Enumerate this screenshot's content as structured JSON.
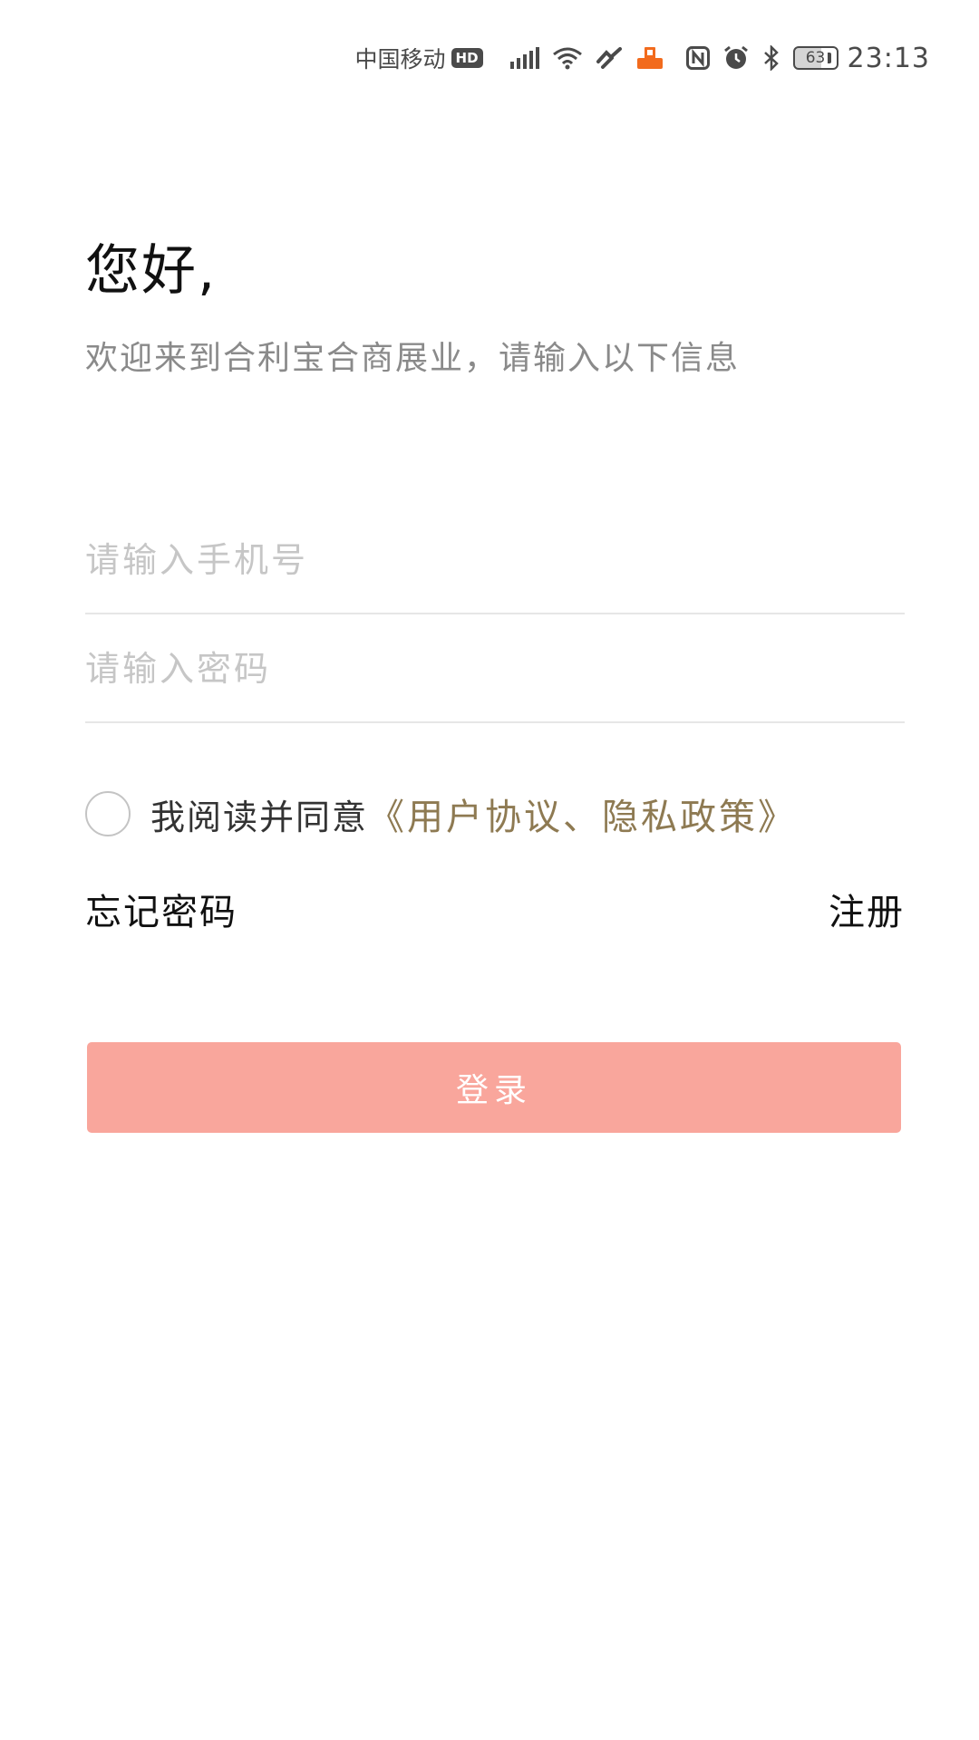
{
  "status_bar": {
    "carrier": "中国移动",
    "hd_label": "HD",
    "battery": "63",
    "time": "23:13",
    "icons": [
      "signal-icon",
      "wifi-icon",
      "link-icon",
      "app-notification-icon",
      "nfc-icon",
      "alarm-icon",
      "bluetooth-icon",
      "battery-icon"
    ]
  },
  "greeting": "您好,",
  "subtitle": "欢迎来到合利宝合商展业，请输入以下信息",
  "form": {
    "phone_placeholder": "请输入手机号",
    "password_placeholder": "请输入密码"
  },
  "agreement": {
    "text": "我阅读并同意",
    "link": "《用户协议、隐私政策》"
  },
  "links": {
    "forgot_password": "忘记密码",
    "register": "注册"
  },
  "login_button": "登录",
  "colors": {
    "login_button_bg": "#f9a69c",
    "agreement_link": "#8e7a52"
  }
}
